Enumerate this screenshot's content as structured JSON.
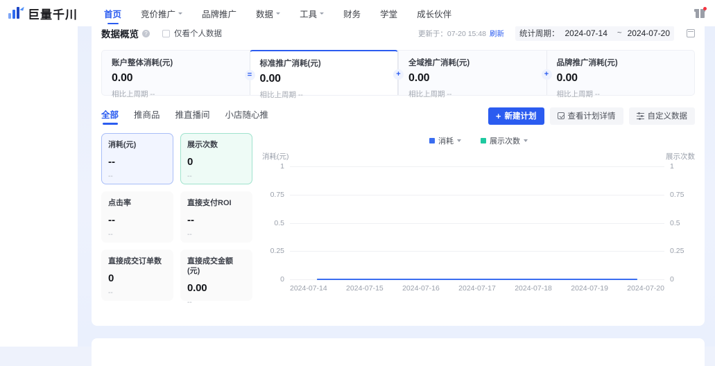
{
  "nav": {
    "brand": "巨量千川",
    "items": [
      {
        "label": "首页",
        "has_caret": false,
        "active": true
      },
      {
        "label": "竞价推广",
        "has_caret": true,
        "active": false
      },
      {
        "label": "品牌推广",
        "has_caret": false,
        "active": false
      },
      {
        "label": "数据",
        "has_caret": true,
        "active": false
      },
      {
        "label": "工具",
        "has_caret": true,
        "active": false
      },
      {
        "label": "财务",
        "has_caret": false,
        "active": false
      },
      {
        "label": "学堂",
        "has_caret": false,
        "active": false
      },
      {
        "label": "成长伙伴",
        "has_caret": false,
        "active": false
      }
    ],
    "gift_icon": "gift-icon"
  },
  "overview": {
    "title": "数据概览",
    "info_icon": "?",
    "checkbox_label": "仅看个人数据",
    "checkbox_checked": false,
    "updated_text": "更新于：07-20 15:48",
    "refresh_label": "刷新",
    "period_label": "统计周期：",
    "period_start": "2024-07-14",
    "period_tilde": "~",
    "period_end": "2024-07-20",
    "calendar_icon": "calendar-icon"
  },
  "summary_cards": [
    {
      "title": "账户整体消耗(元)",
      "value": "0.00",
      "sub": "相比上周期 --",
      "op": "",
      "selected": false
    },
    {
      "title": "标准推广消耗(元)",
      "value": "0.00",
      "sub": "相比上周期 --",
      "op": "=",
      "selected": true
    },
    {
      "title": "全域推广消耗(元)",
      "value": "0.00",
      "sub": "相比上周期 --",
      "op": "+",
      "selected": false
    },
    {
      "title": "品牌推广消耗(元)",
      "value": "0.00",
      "sub": "相比上周期 --",
      "op": "+",
      "selected": false
    }
  ],
  "tabs": [
    {
      "label": "全部",
      "active": true
    },
    {
      "label": "推商品",
      "active": false
    },
    {
      "label": "推直播间",
      "active": false
    },
    {
      "label": "小店随心推",
      "active": false
    }
  ],
  "buttons": {
    "create_plan": "新建计划",
    "view_detail": "查看计划详情",
    "custom_data": "自定义数据"
  },
  "tiles": [
    {
      "title": "消耗(元)",
      "value": "--",
      "sub": "--",
      "style": "sel-blue"
    },
    {
      "title": "展示次数",
      "value": "0",
      "sub": "--",
      "style": "sel-teal"
    },
    {
      "title": "点击率",
      "value": "--",
      "sub": "--",
      "style": ""
    },
    {
      "title": "直接支付ROI",
      "value": "--",
      "sub": "--",
      "style": ""
    },
    {
      "title": "直接成交订单数",
      "value": "0",
      "sub": "--",
      "style": ""
    },
    {
      "title": "直接成交金额(元)",
      "value": "0.00",
      "sub": "--",
      "style": ""
    }
  ],
  "chart_data": {
    "type": "line",
    "title": "",
    "x": [
      "2024-07-14",
      "2024-07-15",
      "2024-07-16",
      "2024-07-17",
      "2024-07-18",
      "2024-07-19",
      "2024-07-20"
    ],
    "xlabel": "",
    "y_left_label": "消耗(元)",
    "y_right_label": "展示次数",
    "y_ticks": [
      "1",
      "0.75",
      "0.5",
      "0.25",
      "0"
    ],
    "y_left_ticks": [
      "1",
      "0.75",
      "0.5",
      "0.25",
      "0"
    ],
    "y_right_ticks": [
      "1",
      "0.75",
      "0.5",
      "0.25",
      "0"
    ],
    "ylim": [
      0,
      1
    ],
    "grid": true,
    "legend_position": "top-center",
    "legend": [
      {
        "name": "消耗",
        "color": "#3a6df0"
      },
      {
        "name": "展示次数",
        "color": "#1fc9a0"
      }
    ],
    "series": [
      {
        "name": "消耗",
        "color": "#3a6df0",
        "values": [
          0,
          0,
          0,
          0,
          0,
          0,
          0
        ]
      },
      {
        "name": "展示次数",
        "color": "#1fc9a0",
        "values": [
          0,
          0,
          0,
          0,
          0,
          0,
          0
        ]
      }
    ]
  }
}
